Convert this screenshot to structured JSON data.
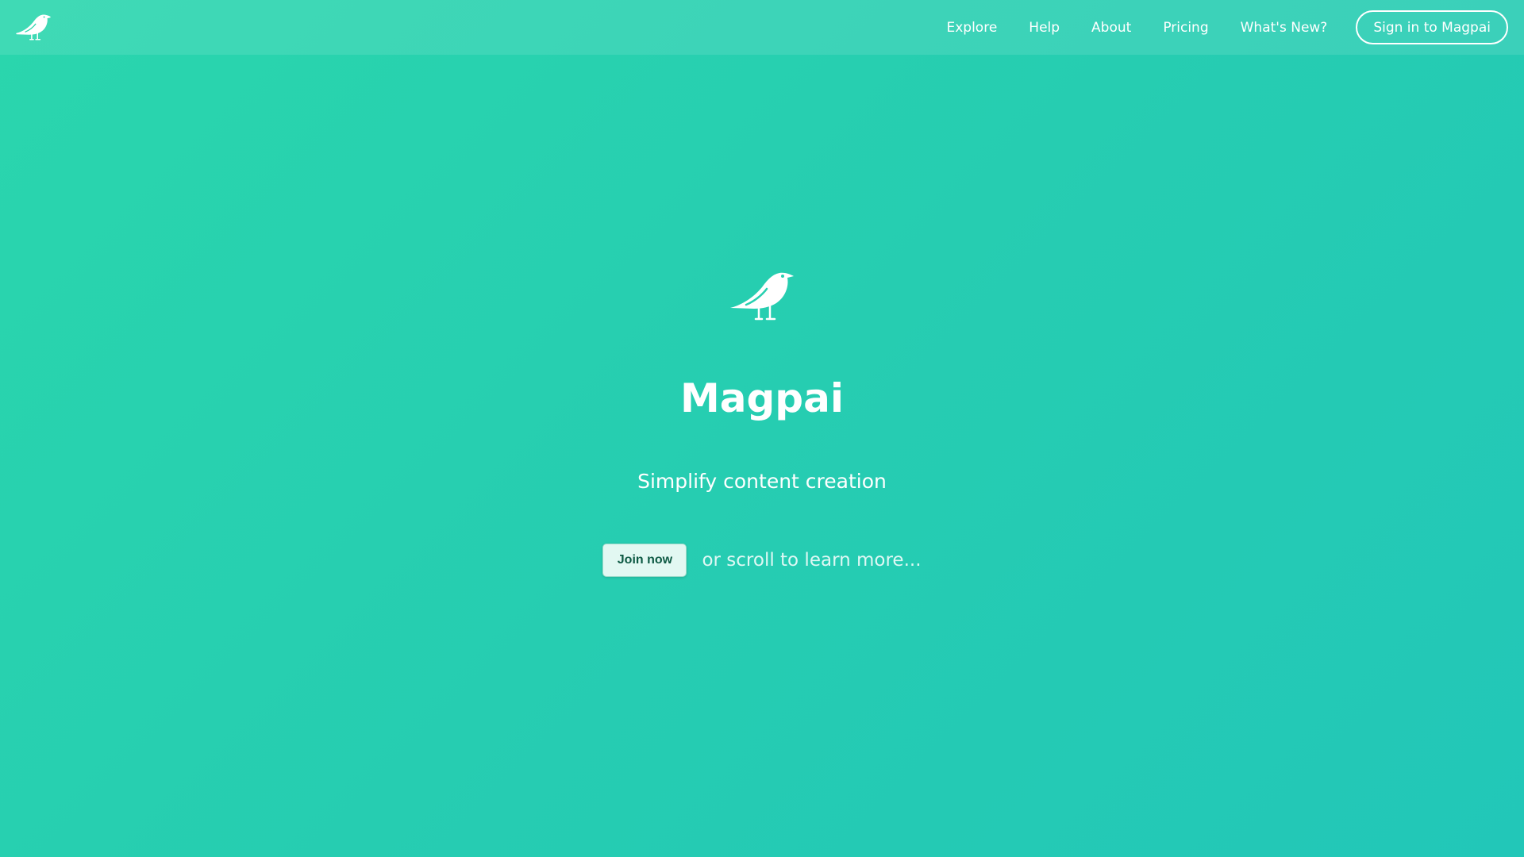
{
  "brand": {
    "name": "Magpai",
    "logo_icon": "magpie-bird-icon"
  },
  "nav": {
    "items": [
      {
        "label": "Explore"
      },
      {
        "label": "Help"
      },
      {
        "label": "About"
      },
      {
        "label": "Pricing"
      },
      {
        "label": "What's New?"
      }
    ],
    "signin_label": "Sign in to Magpai"
  },
  "hero": {
    "title": "Magpai",
    "tagline": "Simplify content creation",
    "join_label": "Join now",
    "scroll_hint": "or scroll to learn more..."
  },
  "colors": {
    "background_start": "#2ad6ad",
    "background_end": "#22c7b8",
    "text": "#ffffff",
    "join_button_bg": "#e2f8f2",
    "join_button_text": "#0e5a44"
  }
}
